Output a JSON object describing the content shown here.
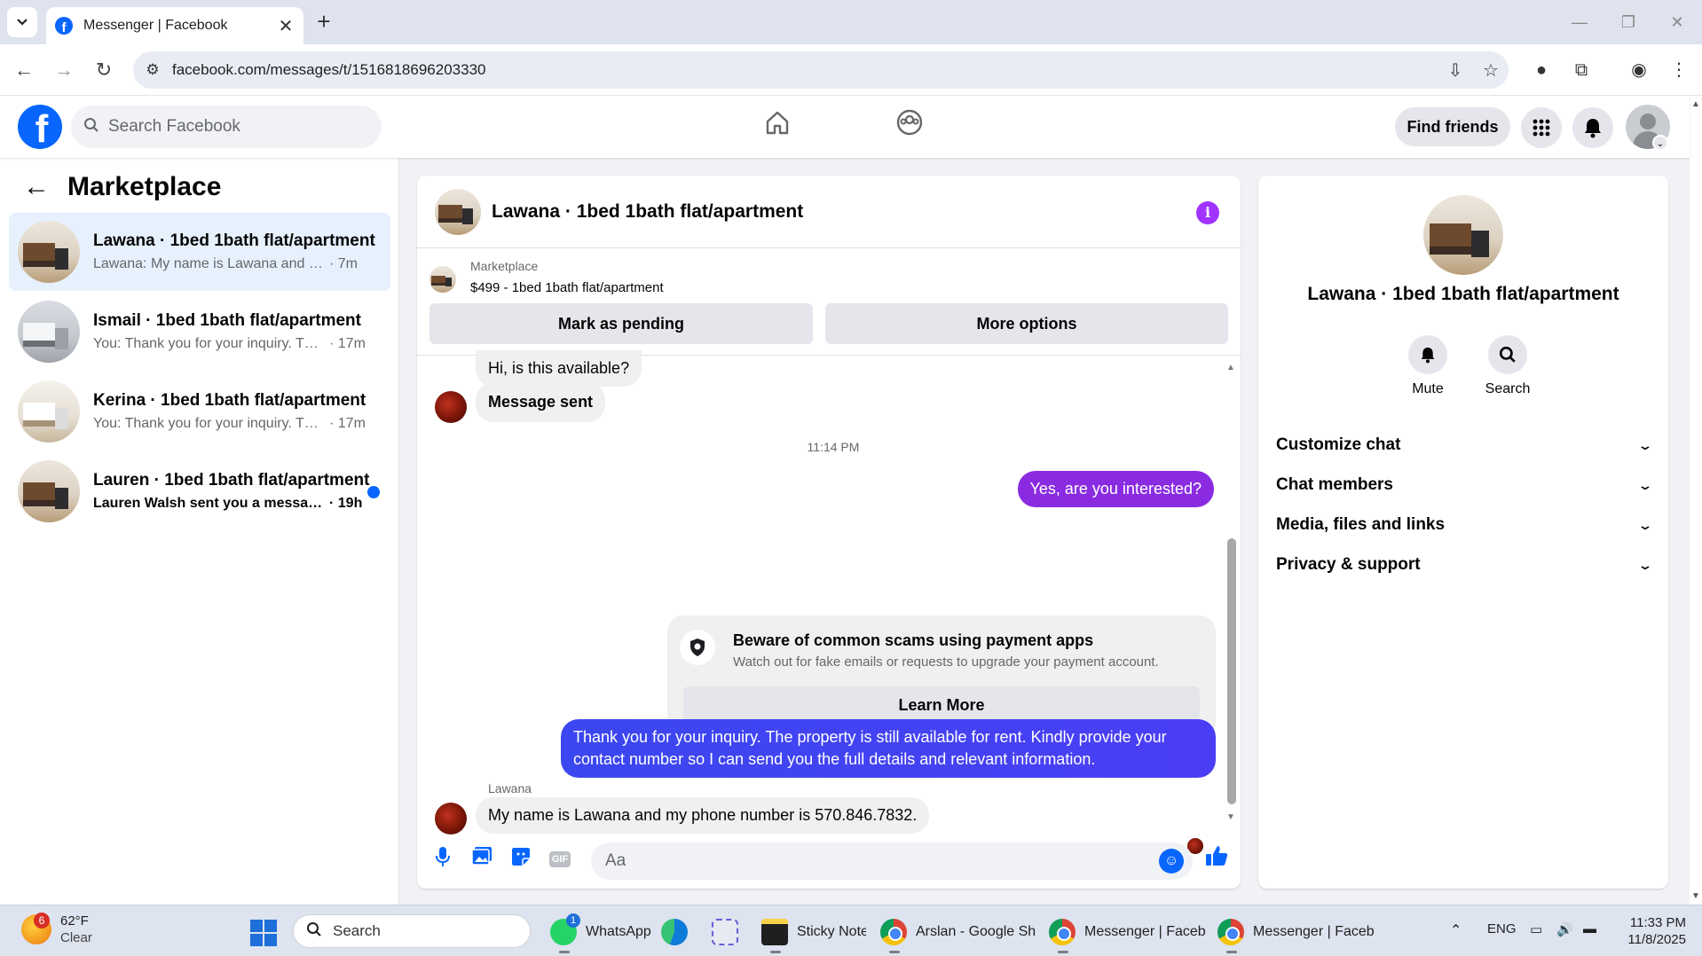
{
  "browser": {
    "tab_title": "Messenger | Facebook",
    "url": "facebook.com/messages/t/1516818696203330",
    "icons": [
      "tab-dropdown-icon",
      "close-icon",
      "plus-icon",
      "back-icon",
      "forward-icon",
      "reload-icon",
      "site-info-icon",
      "install-icon",
      "star-icon",
      "cookie-icon",
      "puzzle-icon",
      "profile-icon",
      "menu-icon"
    ]
  },
  "fb": {
    "search_placeholder": "Search Facebook",
    "find_friends": "Find friends",
    "logo_letter": "f"
  },
  "sidebar": {
    "title": "Marketplace",
    "conversations": [
      {
        "name": "Lawana · 1bed 1bath flat/apartment",
        "snippet": "Lawana: My name is Lawana and my ...",
        "time": "· 7m",
        "active": true,
        "unread": false
      },
      {
        "name": "Ismail · 1bed 1bath flat/apartment",
        "snippet": "You: Thank you for your inquiry. The...",
        "time": "· 17m",
        "active": false,
        "unread": false
      },
      {
        "name": "Kerina · 1bed 1bath flat/apartment",
        "snippet": "You: Thank you for your inquiry. The...",
        "time": "· 17m",
        "active": false,
        "unread": false
      },
      {
        "name": "Lauren · 1bed 1bath flat/apartment",
        "snippet": "Lauren Walsh sent you a message...",
        "time": "· 19h",
        "active": false,
        "unread": true
      }
    ]
  },
  "chat": {
    "title": "Lawana · 1bed 1bath flat/apartment",
    "listing_source": "Marketplace",
    "listing_price": "$499 - 1bed 1bath flat/apartment",
    "mark_pending": "Mark as pending",
    "more_options": "More options",
    "messages": {
      "m1": "Hi, is this available?",
      "m2": "Message sent",
      "timestamp": "11:14 PM",
      "m3": "Yes, are you interested?",
      "warning_title": "Beware of common scams using payment apps",
      "warning_sub": "Watch out for fake emails or requests to upgrade your payment account.",
      "learn_more": "Learn More",
      "m4": "Thank you for your inquiry. The property is still available for rent. Kindly provide your contact number so I can send you the full details and relevant information.",
      "sender": "Lawana",
      "m5": "My name is Lawana and my phone number is 570.846.7832."
    },
    "composer_placeholder": "Aa",
    "gif_label": "GIF"
  },
  "details": {
    "title": "Lawana · 1bed 1bath flat/apartment",
    "mute": "Mute",
    "search": "Search",
    "sections": [
      "Customize chat",
      "Chat members",
      "Media, files and links",
      "Privacy & support"
    ]
  },
  "taskbar": {
    "weather_temp": "62°F",
    "weather_cond": "Clear",
    "weather_badge": "6",
    "search": "Search",
    "apps": {
      "whatsapp": "WhatsApp",
      "whatsapp_badge": "1",
      "sticky": "Sticky Note",
      "chrome1": "Arslan - Google Sh",
      "chrome2": "Messenger | Faceb",
      "chrome3": "Messenger | Faceb"
    },
    "lang": "ENG",
    "time": "11:33 PM",
    "date": "11/8/2025"
  },
  "colors": {
    "fb_blue": "#0866ff",
    "outgoing_bubble": "#3b47f0",
    "outgoing_purple": "#8a2be2",
    "active_row": "#e7f1fe"
  }
}
